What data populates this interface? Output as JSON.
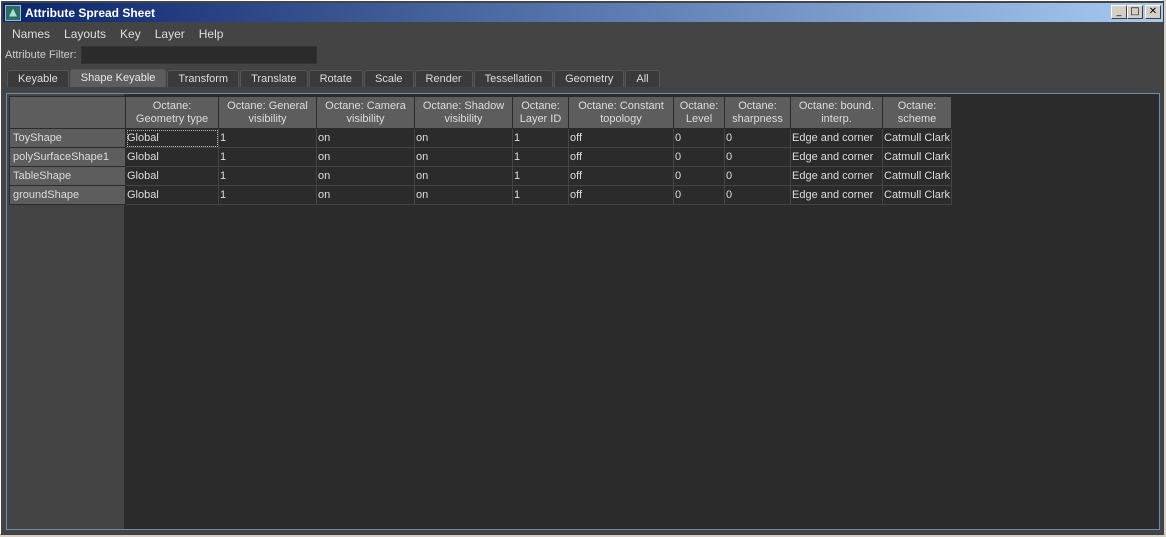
{
  "window": {
    "title": "Attribute Spread Sheet",
    "buttons": {
      "minimize": "_",
      "maximize": "□",
      "close": "✕"
    }
  },
  "menu": [
    "Names",
    "Layouts",
    "Key",
    "Layer",
    "Help"
  ],
  "filter": {
    "label": "Attribute Filter:",
    "value": ""
  },
  "tabs": [
    {
      "label": "Keyable",
      "active": false
    },
    {
      "label": "Shape Keyable",
      "active": true
    },
    {
      "label": "Transform",
      "active": false
    },
    {
      "label": "Translate",
      "active": false
    },
    {
      "label": "Rotate",
      "active": false
    },
    {
      "label": "Scale",
      "active": false
    },
    {
      "label": "Render",
      "active": false
    },
    {
      "label": "Tessellation",
      "active": false
    },
    {
      "label": "Geometry",
      "active": false
    },
    {
      "label": "All",
      "active": false
    }
  ],
  "columns": [
    [
      "Octane:",
      "Geometry type"
    ],
    [
      "Octane: General",
      "visibility"
    ],
    [
      "Octane: Camera",
      "visibility"
    ],
    [
      "Octane: Shadow",
      "visibility"
    ],
    [
      "Octane:",
      "Layer ID"
    ],
    [
      "Octane: Constant",
      "topology"
    ],
    [
      "Octane:",
      "Level"
    ],
    [
      "Octane:",
      "sharpness"
    ],
    [
      "Octane: bound.",
      "interp."
    ],
    [
      "Octane:",
      "scheme"
    ]
  ],
  "rows": [
    {
      "name": "ToyShape",
      "cells": [
        "Global",
        "1",
        "on",
        "on",
        "1",
        "off",
        "0",
        "0",
        "Edge and corner",
        "Catmull Clark"
      ]
    },
    {
      "name": "polySurfaceShape1",
      "cells": [
        "Global",
        "1",
        "on",
        "on",
        "1",
        "off",
        "0",
        "0",
        "Edge and corner",
        "Catmull Clark"
      ]
    },
    {
      "name": "TableShape",
      "cells": [
        "Global",
        "1",
        "on",
        "on",
        "1",
        "off",
        "0",
        "0",
        "Edge and corner",
        "Catmull Clark"
      ]
    },
    {
      "name": "groundShape",
      "cells": [
        "Global",
        "1",
        "on",
        "on",
        "1",
        "off",
        "0",
        "0",
        "Edge and corner",
        "Catmull Clark"
      ]
    }
  ]
}
